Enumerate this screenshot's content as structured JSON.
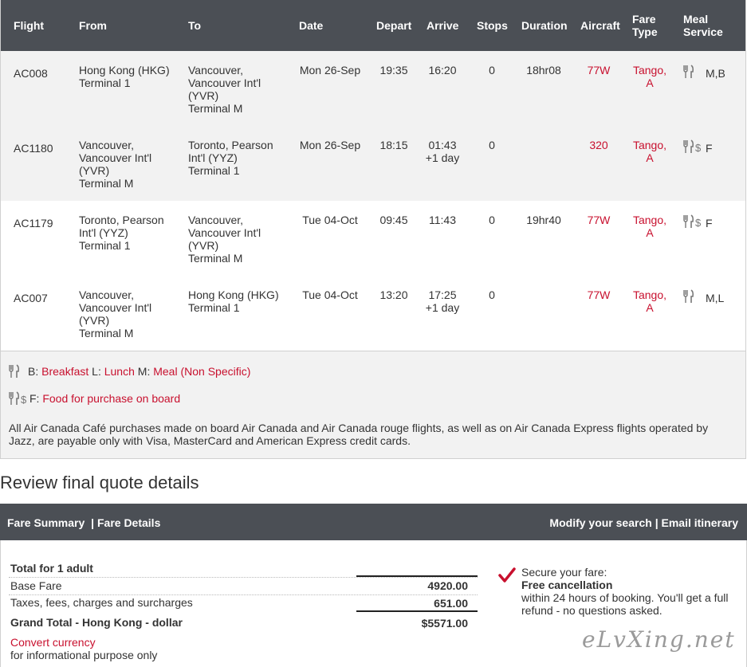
{
  "table": {
    "headers": {
      "flight": "Flight",
      "from": "From",
      "to": "To",
      "date": "Date",
      "depart": "Depart",
      "arrive": "Arrive",
      "stops": "Stops",
      "duration": "Duration",
      "aircraft": "Aircraft",
      "fare_type_1": "Fare",
      "fare_type_2": "Type",
      "meal_1": "Meal",
      "meal_2": "Service"
    },
    "rows": [
      {
        "flight": "AC008",
        "from": [
          "Hong Kong (HKG)",
          "Terminal 1"
        ],
        "to": [
          "Vancouver,",
          "Vancouver Int'l",
          "(YVR)",
          "Terminal M"
        ],
        "date": "Mon 26-Sep",
        "depart": "19:35",
        "arrive": [
          "16:20",
          ""
        ],
        "stops": "0",
        "duration": "18hr08",
        "aircraft": "77W",
        "fare": [
          "Tango,",
          "A"
        ],
        "meal_icon": "fork-knife-icon",
        "meal": "M,B"
      },
      {
        "flight": "AC1180",
        "from": [
          "Vancouver,",
          "Vancouver Int'l",
          "(YVR)",
          "Terminal M"
        ],
        "to": [
          "Toronto, Pearson",
          "Int'l (YYZ)",
          "Terminal 1"
        ],
        "date": "Mon 26-Sep",
        "depart": "18:15",
        "arrive": [
          "01:43",
          "+1 day"
        ],
        "stops": "0",
        "duration": "",
        "aircraft": "320",
        "fare": [
          "Tango,",
          "A"
        ],
        "meal_icon": "fork-knife-dollar-icon",
        "meal": "F"
      },
      {
        "flight": "AC1179",
        "from": [
          "Toronto, Pearson",
          "Int'l (YYZ)",
          "Terminal 1"
        ],
        "to": [
          "Vancouver,",
          "Vancouver Int'l",
          "(YVR)",
          "Terminal M"
        ],
        "date": "Tue 04-Oct",
        "depart": "09:45",
        "arrive": [
          "11:43",
          ""
        ],
        "stops": "0",
        "duration": "19hr40",
        "aircraft": "77W",
        "fare": [
          "Tango,",
          "A"
        ],
        "meal_icon": "fork-knife-dollar-icon",
        "meal": "F"
      },
      {
        "flight": "AC007",
        "from": [
          "Vancouver,",
          "Vancouver Int'l",
          "(YVR)",
          "Terminal M"
        ],
        "to": [
          "Hong Kong (HKG)",
          "Terminal 1"
        ],
        "date": "Tue 04-Oct",
        "depart": "13:20",
        "arrive": [
          "17:25",
          "+1 day"
        ],
        "stops": "0",
        "duration": "",
        "aircraft": "77W",
        "fare": [
          "Tango,",
          "A"
        ],
        "meal_icon": "fork-knife-icon",
        "meal": "M,L"
      }
    ]
  },
  "legend": {
    "b_code": "B:",
    "b_label": "Breakfast",
    "l_code": "L:",
    "l_label": "Lunch",
    "m_code": "M:",
    "m_label": "Meal (Non Specific)",
    "f_code": "F:",
    "f_label": "Food for purchase on board",
    "note": "All Air Canada Café purchases made on board Air Canada and Air Canada rouge flights, as well as on Air Canada Express flights operated by Jazz, are payable only with Visa, MasterCard and American Express credit cards."
  },
  "review": {
    "title": "Review final quote details",
    "tabs": {
      "fare_summary": "Fare Summary",
      "fare_details": "| Fare Details",
      "modify": "Modify your search",
      "sep": "|",
      "email": "Email itinerary"
    },
    "total_label": "Total for 1 adult",
    "base_fare_label": "Base Fare",
    "base_fare_value": "4920.00",
    "taxes_label": "Taxes, fees, charges and surcharges",
    "taxes_value": "651.00",
    "grand_total_label": "Grand Total - Hong Kong - dollar",
    "grand_total_value": "$5571.00",
    "convert_link": "Convert currency",
    "convert_note": "for informational purpose only",
    "secure_line1": "Secure your fare:",
    "secure_line2": "Free cancellation",
    "secure_line3": "within 24 hours of booking. You'll get a full refund - no questions asked."
  },
  "watermark": "eLvXing.net",
  "colors": {
    "header_bg": "#4b4f55",
    "accent_red": "#c8102e",
    "row_alt": "#f2f2f2"
  }
}
